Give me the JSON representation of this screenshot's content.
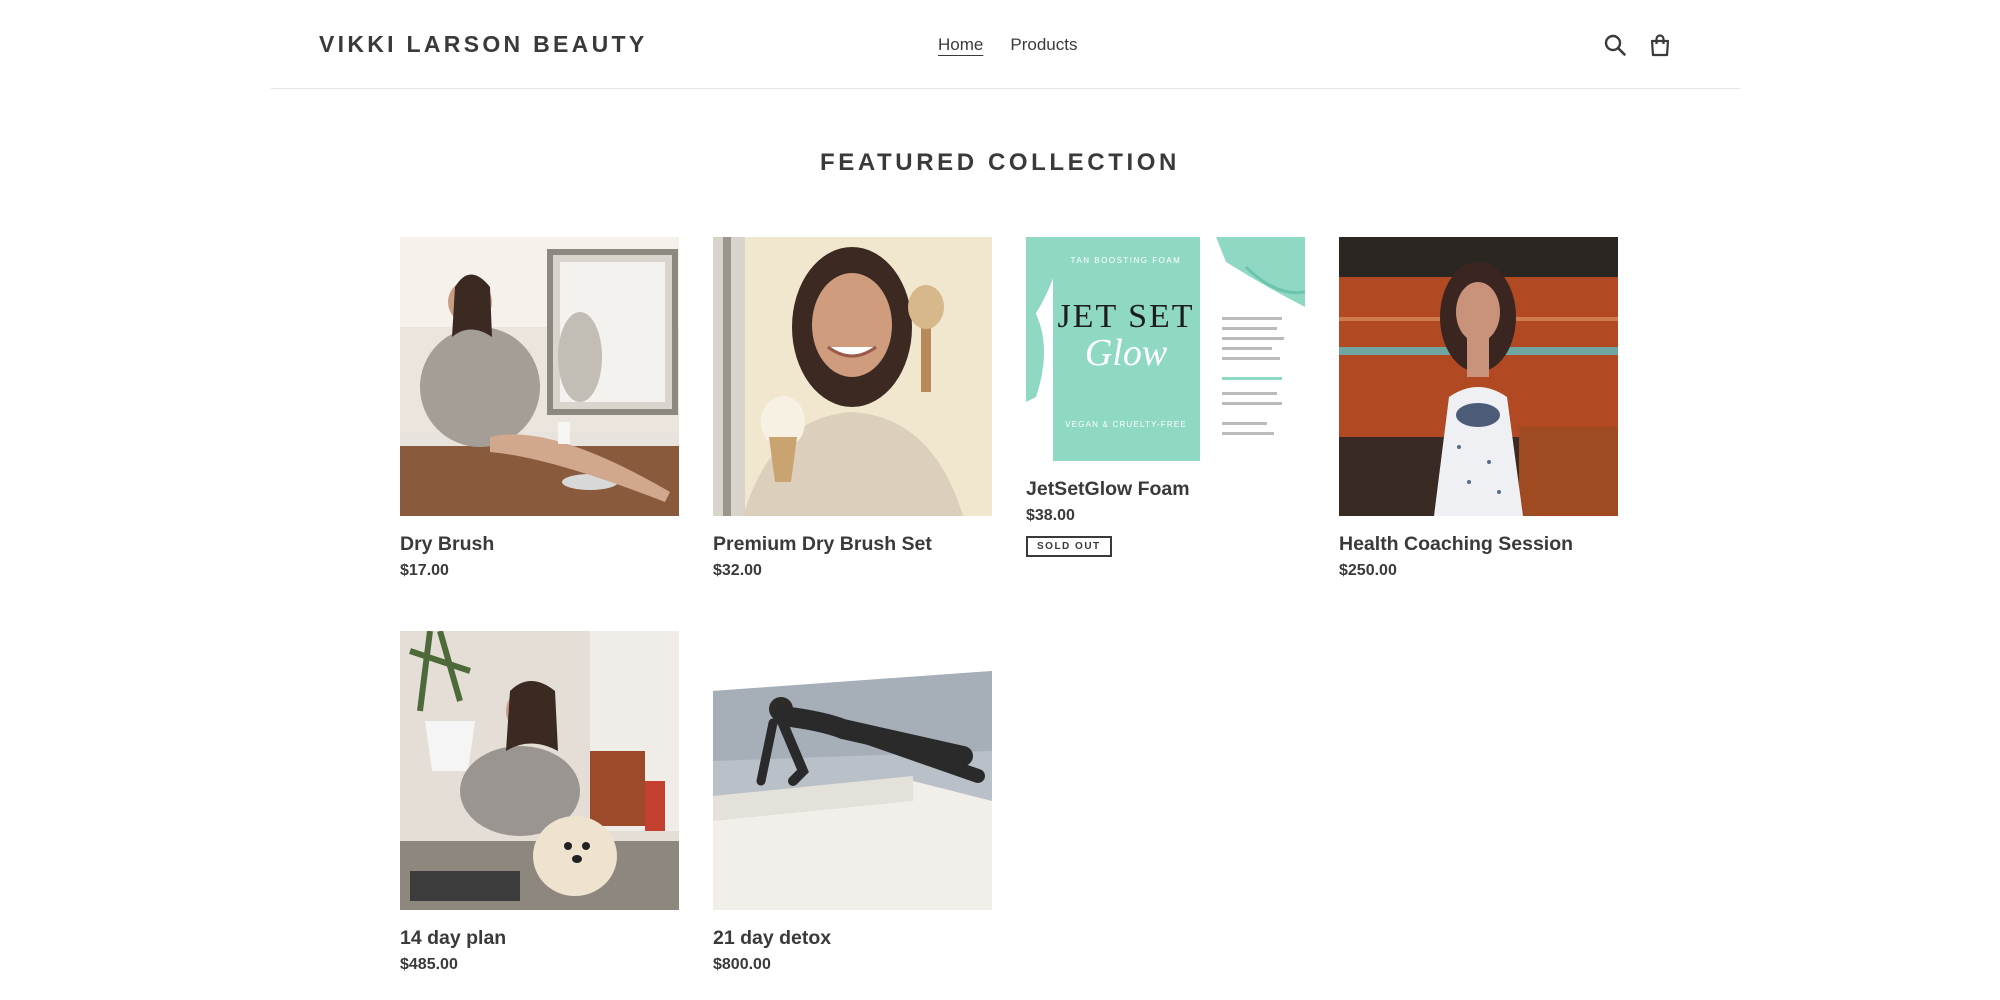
{
  "header": {
    "logo": "VIKKI LARSON BEAUTY",
    "nav": [
      {
        "label": "Home",
        "active": true
      },
      {
        "label": "Products",
        "active": false
      }
    ],
    "icons": [
      "search-icon",
      "cart-icon"
    ]
  },
  "featured": {
    "title": "FEATURED COLLECTION",
    "products": [
      {
        "title": "Dry Brush",
        "price": "$17.00"
      },
      {
        "title": "Premium Dry Brush Set",
        "price": "$32.00"
      },
      {
        "title": "JetSetGlow Foam",
        "price": "$38.00",
        "badge": "SOLD OUT"
      },
      {
        "title": "Health Coaching Session",
        "price": "$250.00"
      },
      {
        "title": "14 day plan",
        "price": "$485.00"
      },
      {
        "title": "21 day detox",
        "price": "$800.00"
      }
    ]
  },
  "jetset_image": {
    "top_text": "TAN BOOSTING FOAM",
    "brand_line1": "JET SET",
    "brand_line2": "Glow",
    "bottom_text": "VEGAN & CRUELTY-FREE"
  },
  "colors": {
    "text": "#3a3a3a",
    "divider": "#e6e6e6",
    "mint": "#8ed8c4"
  }
}
